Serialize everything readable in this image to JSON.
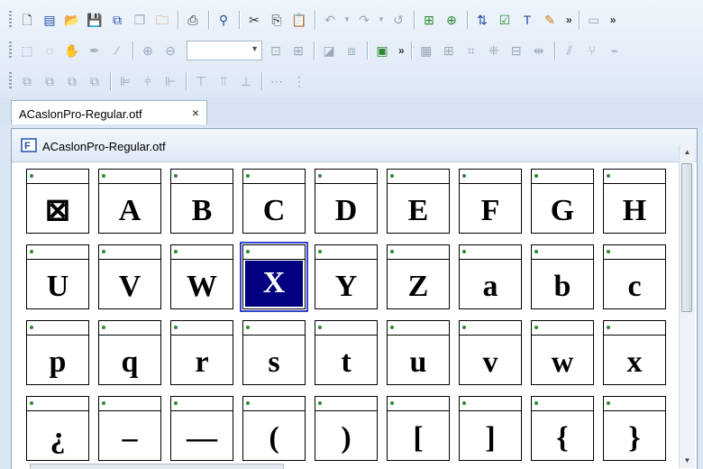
{
  "toolbar": {
    "row1_icons": [
      "new-icon",
      "properties-icon",
      "open-icon",
      "save-icon",
      "save-all-icon",
      "copy-project-icon",
      "open-folder-icon",
      "print-icon",
      "find-icon",
      "cut-icon",
      "copy-icon",
      "paste-icon",
      "undo-icon",
      "undo-dropdown-icon",
      "redo-icon",
      "redo-dropdown-icon",
      "refresh-icon",
      "add-glyph-icon",
      "add-glyph-2-icon",
      "sort-icon",
      "validate-icon",
      "text-icon",
      "auto-hint-icon"
    ],
    "row2_icons": [
      "select-rect-icon",
      "lasso-icon",
      "hand-icon",
      "pen-icon",
      "knife-icon",
      "zoom-in-icon",
      "zoom-out-icon",
      "fit-icon",
      "grid-snap-icon",
      "mask-icon",
      "metrics-icon",
      "image-icon",
      "table-icon",
      "transform-icon",
      "components-icon",
      "nodes-icon",
      "baseline-icon",
      "flip-icon",
      "branch-icon"
    ],
    "row3_icons": [
      "align-left-icon",
      "align-center-icon",
      "align-right-icon",
      "align-justify-icon",
      "distribute-left-icon",
      "distribute-center-icon",
      "distribute-right-icon",
      "align-top-icon",
      "align-middle-icon",
      "align-bottom-icon",
      "spacing-h-icon",
      "spacing-v-icon"
    ],
    "zoom_value": "",
    "overflow": "»"
  },
  "tab": {
    "label": "ACaslonPro-Regular.otf",
    "close": "×"
  },
  "document": {
    "title": "ACaslonPro-Regular.otf"
  },
  "glyphs": [
    "⊠",
    "A",
    "B",
    "C",
    "D",
    "E",
    "F",
    "G",
    "H",
    "U",
    "V",
    "W",
    "X",
    "Y",
    "Z",
    "a",
    "b",
    "c",
    "p",
    "q",
    "r",
    "s",
    "t",
    "u",
    "v",
    "w",
    "x",
    "¿",
    "–",
    "—",
    "(",
    ")",
    "[",
    "]",
    "{",
    "}"
  ],
  "selected_glyph": "X",
  "colors": {
    "selection": "#000080",
    "accent": "#3344cc",
    "status_dot": "#2c8a2c"
  }
}
